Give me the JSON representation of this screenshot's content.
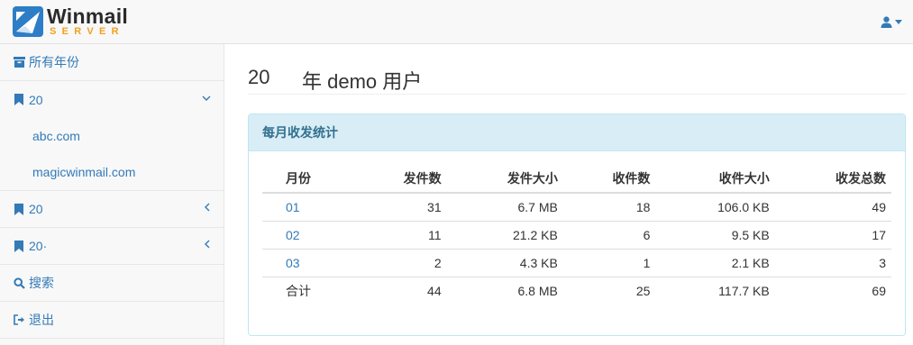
{
  "header": {
    "logo_name": "Winmail",
    "logo_sub": "SERVER",
    "user_icon": "user-icon"
  },
  "sidebar": {
    "all_years": "所有年份",
    "groups": [
      {
        "label": "20",
        "expanded": true,
        "children": [
          "abc.com",
          "magicwinmail.com"
        ]
      },
      {
        "label": "20",
        "expanded": false
      },
      {
        "label": "20·",
        "expanded": false
      }
    ],
    "search": "搜索",
    "logout": "退出"
  },
  "main": {
    "title_year": "20",
    "title_rest": "年 demo 用户",
    "panel_title": "每月收发统计",
    "columns": [
      "月份",
      "发件数",
      "发件大小",
      "收件数",
      "收件大小",
      "收发总数"
    ],
    "rows": [
      [
        "01",
        "31",
        "6.7 MB",
        "18",
        "106.0 KB",
        "49"
      ],
      [
        "02",
        "11",
        "21.2 KB",
        "6",
        "9.5 KB",
        "17"
      ],
      [
        "03",
        "2",
        "4.3 KB",
        "1",
        "2.1 KB",
        "3"
      ]
    ],
    "total": [
      "合计",
      "44",
      "6.8 MB",
      "25",
      "117.7 KB",
      "69"
    ]
  }
}
